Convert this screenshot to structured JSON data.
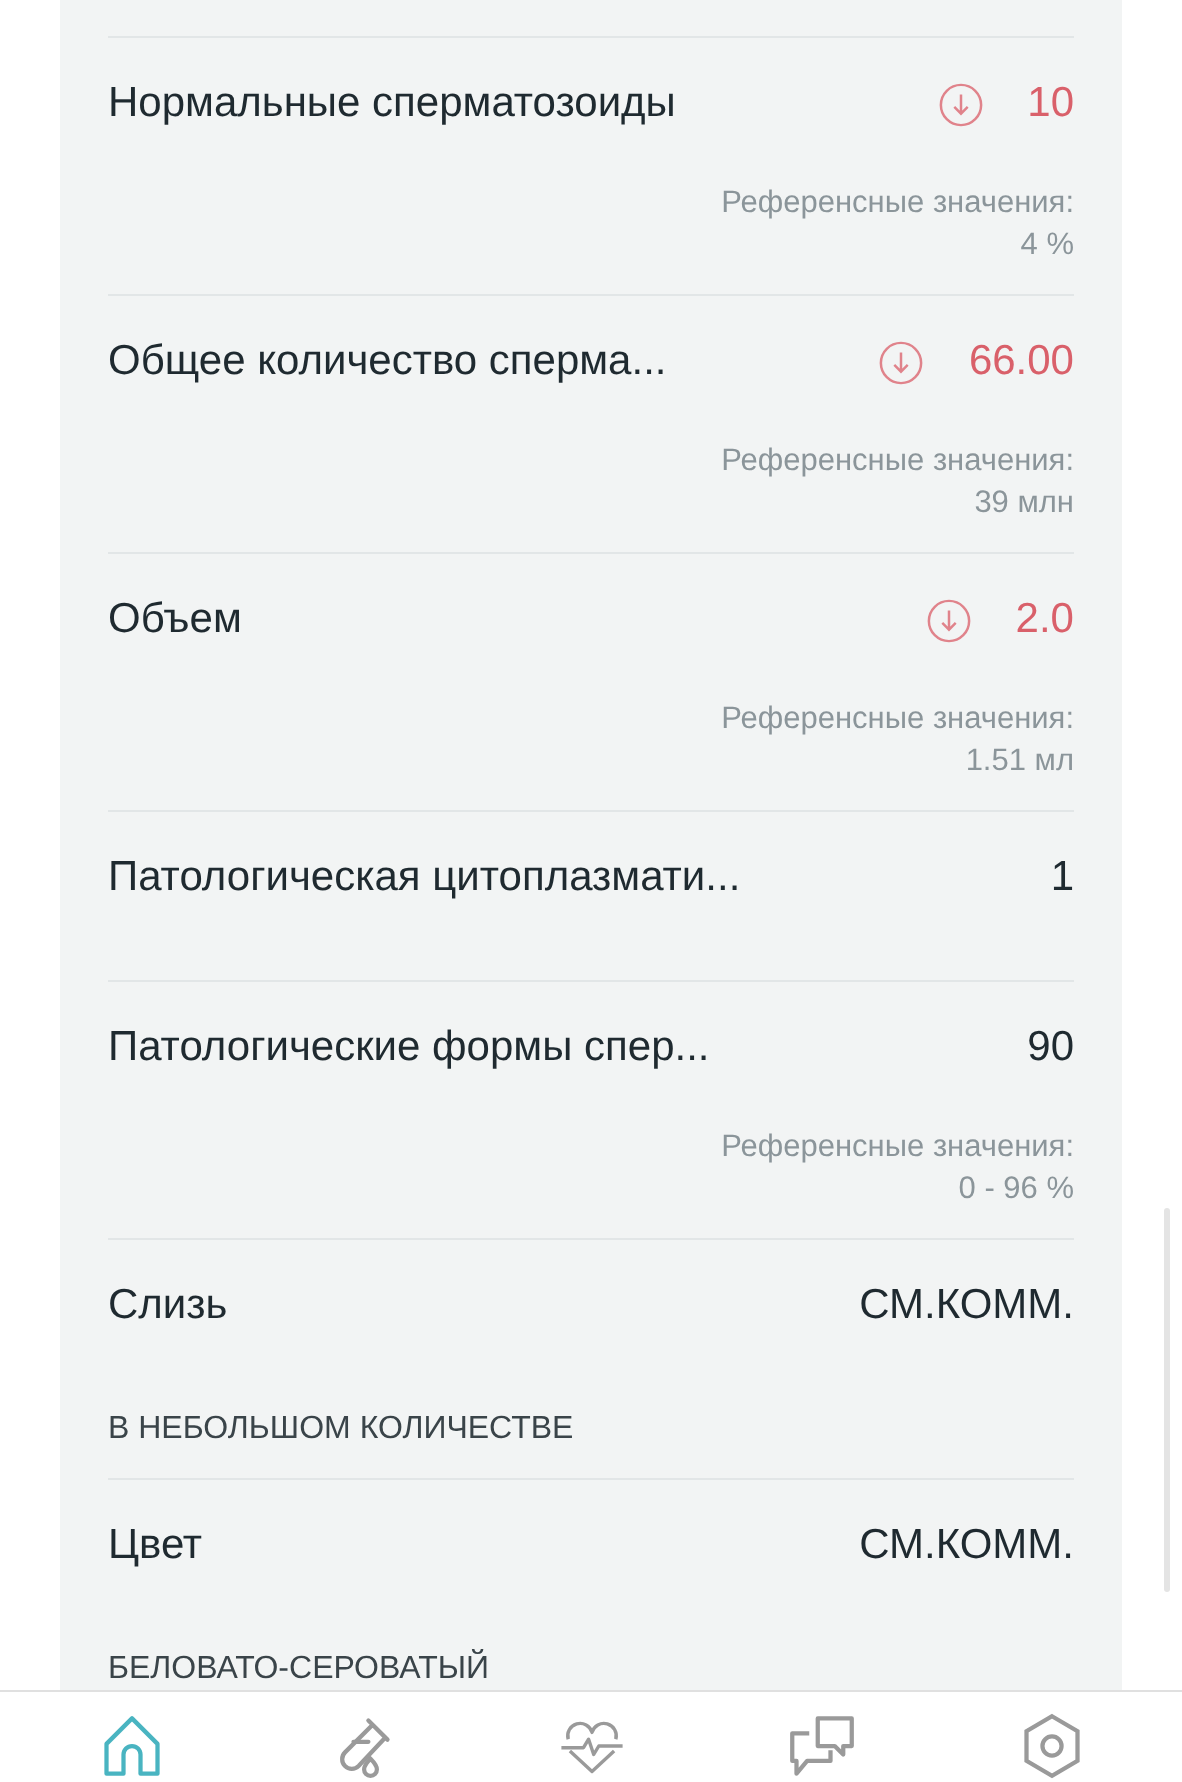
{
  "results": [
    {
      "name": "Нормальные сперматозоиды",
      "value": "10",
      "low": true,
      "reference": {
        "label": "Референсные значения:",
        "value": "4 %"
      }
    },
    {
      "name": "Общее количество сперма...",
      "value": "66.00",
      "low": true,
      "reference": {
        "label": "Референсные значения:",
        "value": "39 млн"
      }
    },
    {
      "name": "Объем",
      "value": "2.0",
      "low": true,
      "reference": {
        "label": "Референсные значения:",
        "value": "1.51 мл"
      }
    },
    {
      "name": "Патологическая цитоплазмати...",
      "value": "1",
      "low": false
    },
    {
      "name": "Патологические формы спер...",
      "value": "90",
      "low": false,
      "reference": {
        "label": "Референсные значения:",
        "value": "0 - 96 %"
      }
    },
    {
      "name": "Слизь",
      "value": "СМ.КОММ.",
      "low": false,
      "note": "В НЕБОЛЬШОМ КОЛИЧЕСТВЕ"
    },
    {
      "name": "Цвет",
      "value": "СМ.КОММ.",
      "low": false,
      "note": "БЕЛОВАТО-СЕРОВАТЫЙ"
    }
  ],
  "tabs": [
    {
      "kind": "home",
      "selected": true
    },
    {
      "kind": "tests",
      "selected": false
    },
    {
      "kind": "health",
      "selected": false
    },
    {
      "kind": "chat",
      "selected": false
    },
    {
      "kind": "settings",
      "selected": false
    }
  ]
}
